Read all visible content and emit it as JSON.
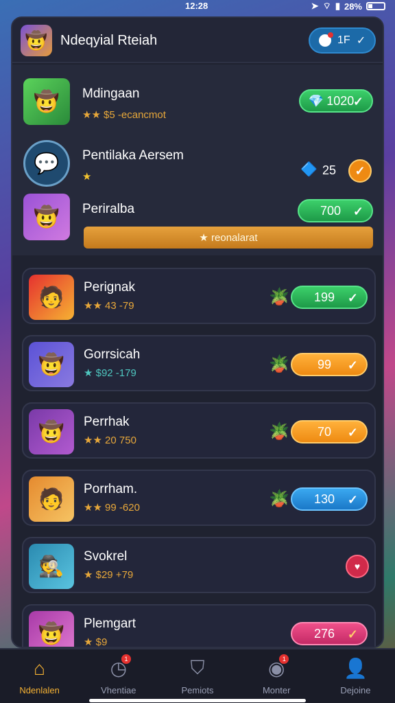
{
  "status": {
    "time": "12:28",
    "battery": "28%"
  },
  "header": {
    "title": "Ndeqyial Rteiah",
    "pill_value": "1F",
    "avatar_icon": "cowboy-avatar-icon"
  },
  "featured": [
    {
      "name": "Mdingaan",
      "sub_text": "★★ $5 -ecancmot",
      "value": "1020",
      "pill_color": "green"
    },
    {
      "name": "Pentilaka Aersem",
      "sub_text": "★",
      "value": "25",
      "pill_color": "orange"
    },
    {
      "name": "Periralba",
      "sub_text": "",
      "value": "700",
      "pill_color": "green"
    }
  ],
  "reward_bar": {
    "label": "★ reonalarat"
  },
  "list": [
    {
      "name": "Perignak",
      "sub_text": "★★ 43 -79",
      "value": "199",
      "pill_color": "green"
    },
    {
      "name": "Gorrsicah",
      "sub_text": "★ $92 -179",
      "value": "99",
      "pill_color": "orange"
    },
    {
      "name": "Perrhak",
      "sub_text": "★★ 20 750",
      "value": "70",
      "pill_color": "orange"
    },
    {
      "name": "Porrham.",
      "sub_text": "★★ 99 -620",
      "value": "130",
      "pill_color": "blue"
    },
    {
      "name": "Svokrel",
      "sub_text": "★ $29 +79",
      "value": "",
      "pill_color": "pink"
    },
    {
      "name": "Plemgart",
      "sub_text": "★ $9",
      "value": "276",
      "pill_color": "pink"
    }
  ],
  "tabs": [
    {
      "label": "Ndenlalen",
      "icon": "home-icon",
      "active": true
    },
    {
      "label": "Vhentiae",
      "icon": "clock-icon",
      "badge": "1"
    },
    {
      "label": "Pemiots",
      "icon": "shield-icon"
    },
    {
      "label": "Monter",
      "icon": "compass-icon",
      "badge": "1"
    },
    {
      "label": "Dejoine",
      "icon": "profile-icon"
    }
  ],
  "colors": {
    "accent": "#f6b233",
    "panel": "#1f2230",
    "green": "#3ccf6a",
    "orange": "#ffb13b",
    "blue": "#3aa8f0",
    "pink": "#f0508a"
  }
}
